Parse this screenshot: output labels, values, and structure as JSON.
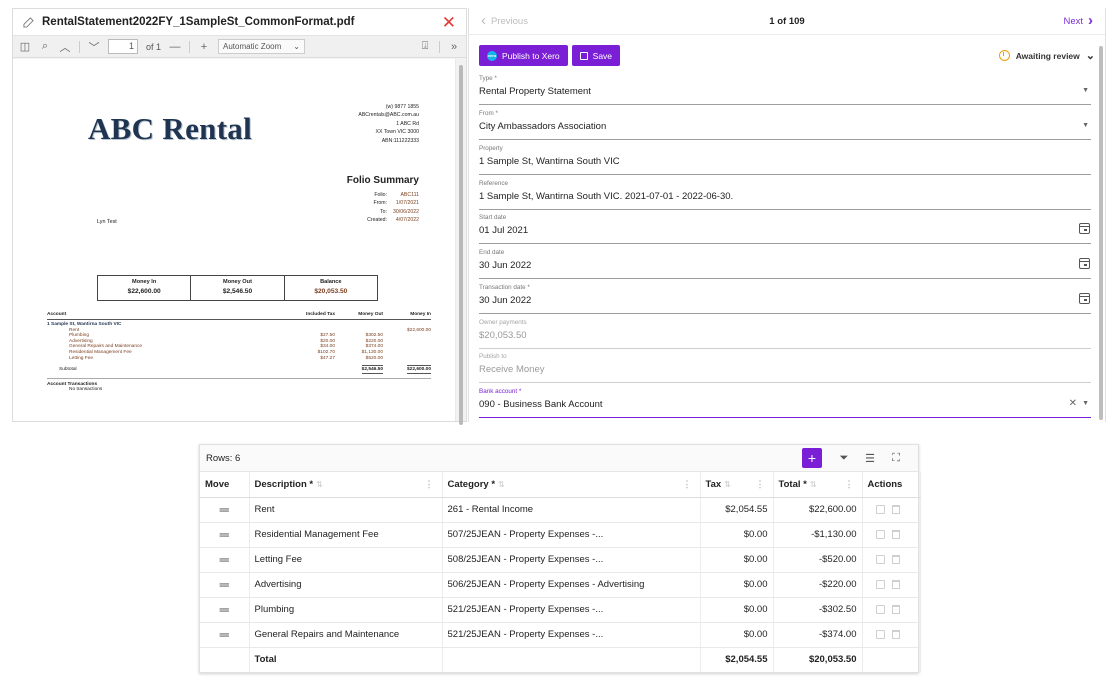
{
  "pdf": {
    "filename": "RentalStatement2022FY_1SampleSt_CommonFormat.pdf",
    "toolbar": {
      "page_value": "1",
      "page_of": "of 1",
      "zoom_label": "Automatic Zoom"
    },
    "logo": "ABC Rental",
    "address_lines": [
      "(w) 9877 1855",
      "ABCrentals@ABC.com.au",
      "1 ABC Rd",
      "XX Town VIC 3000",
      "ABN:111222333"
    ],
    "folio_title": "Folio Summary",
    "folio": [
      {
        "key": "Folio:",
        "value": "ABC111"
      },
      {
        "key": "From:",
        "value": "1/07/2021"
      },
      {
        "key": "To:",
        "value": "30/06/2022"
      },
      {
        "key": "Created:",
        "value": "4/07/2022"
      }
    ],
    "tenant": "Lyn Test",
    "summary": [
      {
        "label": "Money In",
        "value": "$22,600.00"
      },
      {
        "label": "Money Out",
        "value": "$2,546.50"
      },
      {
        "label": "Balance",
        "value": "$20,053.50"
      }
    ],
    "ledger_headers": {
      "account": "Account",
      "tax": "Included Tax",
      "out": "Money Out",
      "in": "Money In"
    },
    "property_line": "1 Sample St, Wantirna South VIC",
    "ledger_items": [
      {
        "account": "Rent",
        "tax": "",
        "out": "",
        "in": "$22,600.00"
      },
      {
        "account": "Plumbing",
        "tax": "$27.50",
        "out": "$302.50",
        "in": ""
      },
      {
        "account": "Advertising",
        "tax": "$20.00",
        "out": "$220.00",
        "in": ""
      },
      {
        "account": "General Repairs and Maintenance",
        "tax": "$34.00",
        "out": "$374.00",
        "in": ""
      },
      {
        "account": "Residential Management Fee",
        "tax": "$102.70",
        "out": "$1,130.00",
        "in": ""
      },
      {
        "account": "Letting Fee",
        "tax": "$47.27",
        "out": "$520.00",
        "in": ""
      }
    ],
    "subtotal": {
      "label": "Subtotal",
      "out": "$2,546.50",
      "in": "$22,600.00"
    },
    "account_transactions": "Account Transactions",
    "no_transactions": "No transactions"
  },
  "nav": {
    "previous": "Previous",
    "pager": "1 of 109",
    "next": "Next"
  },
  "actions": {
    "publish": "Publish to Xero",
    "xero_badge": "xero",
    "save": "Save",
    "status": "Awaiting review"
  },
  "fields": {
    "type": {
      "label": "Type *",
      "value": "Rental Property Statement"
    },
    "from": {
      "label": "From *",
      "value": "City Ambassadors Association"
    },
    "property": {
      "label": "Property",
      "value": "1 Sample St, Wantirna South VIC"
    },
    "reference": {
      "label": "Reference",
      "value": "1 Sample St, Wantirna South VIC. 2021-07-01 - 2022-06-30."
    },
    "start_date": {
      "label": "Start date",
      "value": "01 Jul 2021"
    },
    "end_date": {
      "label": "End date",
      "value": "30 Jun 2022"
    },
    "transaction_date": {
      "label": "Transaction date *",
      "value": "30 Jun 2022"
    },
    "owner_payments": {
      "label": "Owner payments",
      "value": "$20,053.50"
    },
    "publish_to": {
      "label": "Publish to",
      "value": "Receive Money"
    },
    "bank_account": {
      "label": "Bank account *",
      "value": "090 - Business Bank Account"
    }
  },
  "table": {
    "rows_label": "Rows: 6",
    "headers": {
      "move": "Move",
      "description": "Description *",
      "category": "Category *",
      "tax": "Tax",
      "total": "Total *",
      "actions": "Actions"
    },
    "rows": [
      {
        "description": "Rent",
        "category": "261 - Rental Income",
        "tax": "$2,054.55",
        "total": "$22,600.00"
      },
      {
        "description": "Residential Management Fee",
        "category": "507/25JEAN - Property Expenses -...",
        "tax": "$0.00",
        "total": "-$1,130.00"
      },
      {
        "description": "Letting Fee",
        "category": "508/25JEAN - Property Expenses -...",
        "tax": "$0.00",
        "total": "-$520.00"
      },
      {
        "description": "Advertising",
        "category": "506/25JEAN - Property Expenses - Advertising",
        "tax": "$0.00",
        "total": "-$220.00"
      },
      {
        "description": "Plumbing",
        "category": "521/25JEAN - Property Expenses -...",
        "tax": "$0.00",
        "total": "-$302.50"
      },
      {
        "description": "General Repairs and Maintenance",
        "category": "521/25JEAN - Property Expenses -...",
        "tax": "$0.00",
        "total": "-$374.00"
      }
    ],
    "total_row": {
      "label": "Total",
      "tax": "$2,054.55",
      "total": "$20,053.50"
    }
  },
  "colors": {
    "accent": "#7a1fd6",
    "close": "#e53935",
    "status": "#f39c12",
    "xero": "#13b5ea"
  }
}
